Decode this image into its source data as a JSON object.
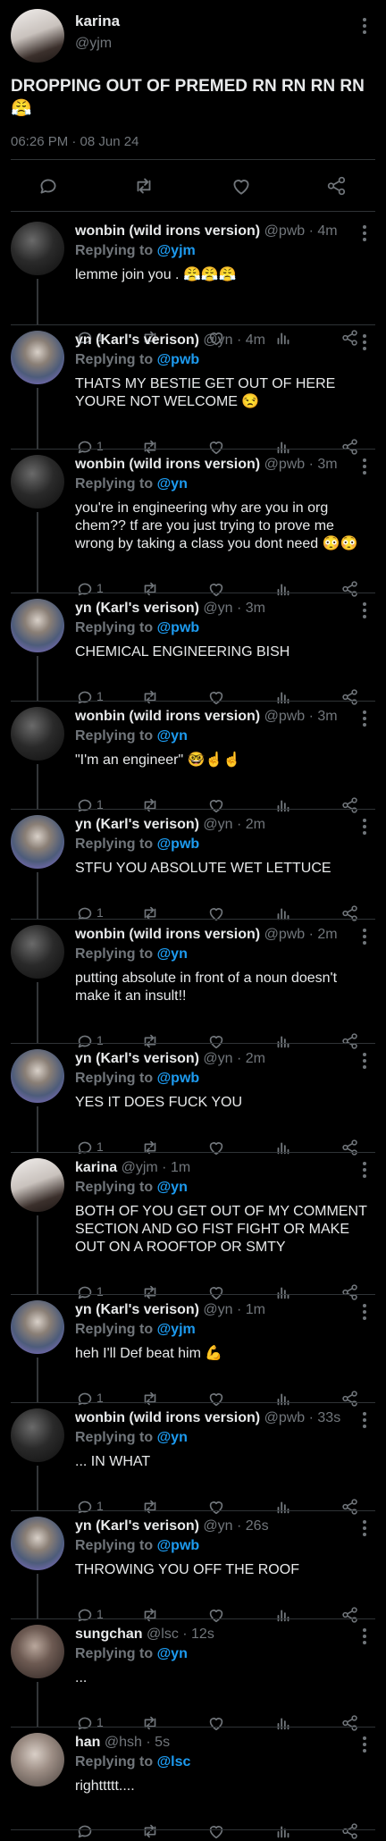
{
  "original_post": {
    "author_name": "karina",
    "handle": "@yjm",
    "text": "DROPPING OUT OF PREMED RN RN RN RN 😤",
    "timestamp": "06:26 PM · 08 Jun 24"
  },
  "replies": [
    {
      "author_name": "wonbin (wild irons version)",
      "meta": "@pwb · 4m",
      "replying_prefix": "Replying to ",
      "replying_to": "@yjm",
      "text": "lemme join you . 😤😤😤",
      "reply_count": "1"
    },
    {
      "author_name": "yn (Karl's verison)",
      "meta": "@yn · 4m",
      "replying_prefix": "Replying to ",
      "replying_to": "@pwb",
      "text": "THATS MY BESTIE GET OUT OF HERE YOURE NOT WELCOME 😒",
      "reply_count": "1"
    },
    {
      "author_name": "wonbin (wild irons version)",
      "meta": "@pwb · 3m",
      "replying_prefix": "Replying to ",
      "replying_to": "@yn",
      "text": "you're in engineering why are you in org chem?? tf are you just trying to prove me wrong by taking a class you dont need 😳😳",
      "reply_count": "1"
    },
    {
      "author_name": "yn (Karl's verison)",
      "meta": "@yn · 3m",
      "replying_prefix": "Replying to ",
      "replying_to": "@pwb",
      "text": "CHEMICAL ENGINEERING BISH",
      "reply_count": "1"
    },
    {
      "author_name": "wonbin (wild irons version)",
      "meta": "@pwb · 3m",
      "replying_prefix": "Replying to ",
      "replying_to": "@yn",
      "text": "\"I'm an engineer\" 🤓☝️☝️",
      "reply_count": "1"
    },
    {
      "author_name": "yn (Karl's verison)",
      "meta": "@yn · 2m",
      "replying_prefix": "Replying to ",
      "replying_to": "@pwb",
      "text": "STFU YOU ABSOLUTE WET LETTUCE",
      "reply_count": "1"
    },
    {
      "author_name": "wonbin (wild irons version)",
      "meta": "@pwb · 2m",
      "replying_prefix": "Replying to ",
      "replying_to": "@yn",
      "text": "putting absolute in front of a noun doesn't make it an insult!!",
      "reply_count": "1"
    },
    {
      "author_name": "yn (Karl's verison)",
      "meta": "@yn · 2m",
      "replying_prefix": "Replying to ",
      "replying_to": "@pwb",
      "text": "YES IT DOES FUCK YOU",
      "reply_count": "1"
    },
    {
      "author_name": "karina",
      "meta": "@yjm · 1m",
      "replying_prefix": "Replying to ",
      "replying_to": "@yn",
      "text": "BOTH OF YOU GET OUT OF MY COMMENT SECTION AND GO FIST FIGHT OR MAKE OUT ON A ROOFTOP OR SMTY",
      "reply_count": "1"
    },
    {
      "author_name": "yn (Karl's verison)",
      "meta": "@yn · 1m",
      "replying_prefix": "Replying to ",
      "replying_to": "@yjm",
      "text": "heh I'll Def beat him 💪",
      "reply_count": "1"
    },
    {
      "author_name": "wonbin (wild irons version)",
      "meta": "@pwb · 33s",
      "replying_prefix": "Replying to ",
      "replying_to": "@yn",
      "text": "... IN WHAT",
      "reply_count": "1"
    },
    {
      "author_name": "yn (Karl's verison)",
      "meta": "@yn · 26s",
      "replying_prefix": "Replying to ",
      "replying_to": "@pwb",
      "text": "THROWING YOU OFF THE ROOF",
      "reply_count": "1"
    },
    {
      "author_name": "sungchan",
      "meta": "@lsc · 12s",
      "replying_prefix": "Replying to ",
      "replying_to": "@yn",
      "text": "...",
      "reply_count": "1"
    },
    {
      "author_name": "han",
      "meta": "@hsh · 5s",
      "replying_prefix": "Replying to ",
      "replying_to": "@lsc",
      "text": "righttttt....",
      "reply_count": ""
    }
  ],
  "icons": {
    "reply": "speech-bubble-icon",
    "retweet": "retweet-icon",
    "like": "heart-icon",
    "views": "bar-chart-icon",
    "share": "share-icon",
    "more": "kebab-icon"
  },
  "colors": {
    "background": "#000000",
    "text": "#e7e9ea",
    "muted": "#71767b",
    "link": "#1d9bf0"
  }
}
